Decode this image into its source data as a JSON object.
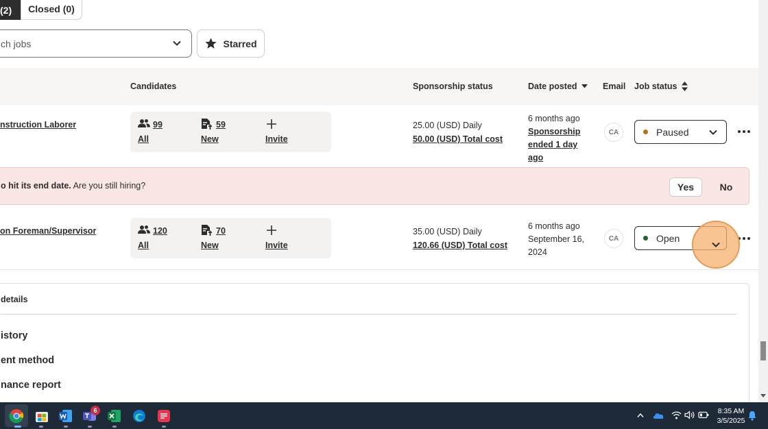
{
  "tabs": {
    "open_partial": "(2)",
    "closed": "Closed (0)"
  },
  "search": {
    "placeholder_partial": "ch jobs"
  },
  "starred_label": "Starred",
  "table_headers": {
    "candidates": "Candidates",
    "sponsorship": "Sponsorship status",
    "date_posted": "Date posted",
    "email": "Email",
    "job_status": "Job status"
  },
  "jobs": [
    {
      "title": "nstruction Laborer",
      "all_count": "99",
      "all_label": "All",
      "new_count": "59",
      "new_label": "New",
      "invite_label": "Invite",
      "sponsorship_rate": "25.00 (USD) Daily",
      "sponsorship_total": "50.00 (USD) Total cost",
      "date_line1": "6 months ago",
      "date_line2": "Sponsorship ended 1 day ago",
      "email_initials": "CA",
      "status": "Paused",
      "status_color": "#b07414"
    },
    {
      "title": "on Foreman/Supervisor",
      "all_count": "120",
      "all_label": "All",
      "new_count": "70",
      "new_label": "New",
      "invite_label": "Invite",
      "sponsorship_rate": "35.00 (USD) Daily",
      "sponsorship_total": "120.66 (USD) Total cost",
      "date_line1": "6 months ago",
      "date_line2": "September 16, 2024",
      "email_initials": "CA",
      "status": "Open",
      "status_color": "#1f662c"
    }
  ],
  "alert": {
    "bold_text": "o hit its end date.",
    "text": " Are you still hiring?",
    "yes": "Yes",
    "no": "No"
  },
  "details": {
    "title": "details",
    "items": [
      "istory",
      "ent method",
      "nance report"
    ]
  },
  "taskbar": {
    "teams_badge": "6",
    "time": "8:35 AM",
    "date": "3/5/2025"
  }
}
